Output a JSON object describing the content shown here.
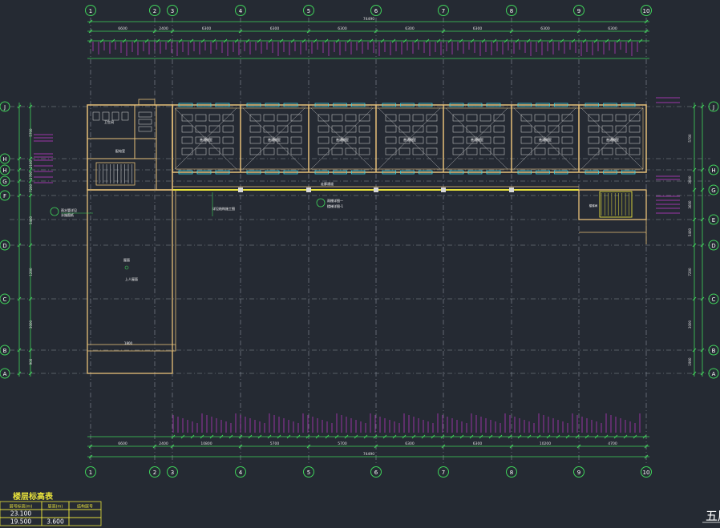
{
  "column_axes": [
    "1",
    "2",
    "3",
    "4",
    "5",
    "6",
    "7",
    "8",
    "9",
    "10"
  ],
  "row_axes_left": [
    "J",
    "H",
    "H",
    "G",
    "F",
    "D",
    "C",
    "B",
    "A"
  ],
  "row_axes_right": [
    "J",
    "H",
    "G",
    "E",
    "D",
    "C",
    "B",
    "A"
  ],
  "dimensions": {
    "overall_top": "74490",
    "overall_bottom": "74490",
    "bays_top": [
      "6600",
      "2400",
      "6300",
      "6300",
      "6300",
      "6300",
      "6300",
      "6300",
      "6300"
    ],
    "bays_bottom": [
      "6600",
      "2400",
      "10800",
      "5700",
      "5700",
      "6300",
      "6300",
      "10200",
      "4700"
    ],
    "left_side": [
      "5700",
      "2100",
      "1700",
      "7200",
      "5400",
      "1200",
      "3000",
      "900",
      "1900"
    ],
    "right_side": [
      "5700",
      "3000",
      "3600",
      "5400",
      "7200",
      "3000",
      "1900"
    ]
  },
  "rooms": {
    "classroom": "普通教室",
    "corridor_label": "走廊通道",
    "stair_label": "楼梯间",
    "platform_label": "上人屋面",
    "roof_label": "屋面",
    "plan_labels": [
      "教室",
      "配电室",
      "卫生间"
    ]
  },
  "notes": {
    "note_left": "雨水管详见",
    "note_left2": "水施图纸",
    "note_mid": "详见结构施工图",
    "note_mid2": "楼梯详图-1",
    "note_mid3": "雨棚详图一",
    "note_platform": "1800"
  },
  "elevation_table": {
    "title": "楼层标高表",
    "headers": [
      "层号标高(m)",
      "层高(m)",
      "结构层号"
    ],
    "rows": [
      [
        "23.100",
        "",
        ""
      ],
      [
        "19.500",
        "3.600",
        ""
      ]
    ]
  },
  "sheet_title": "五层"
}
